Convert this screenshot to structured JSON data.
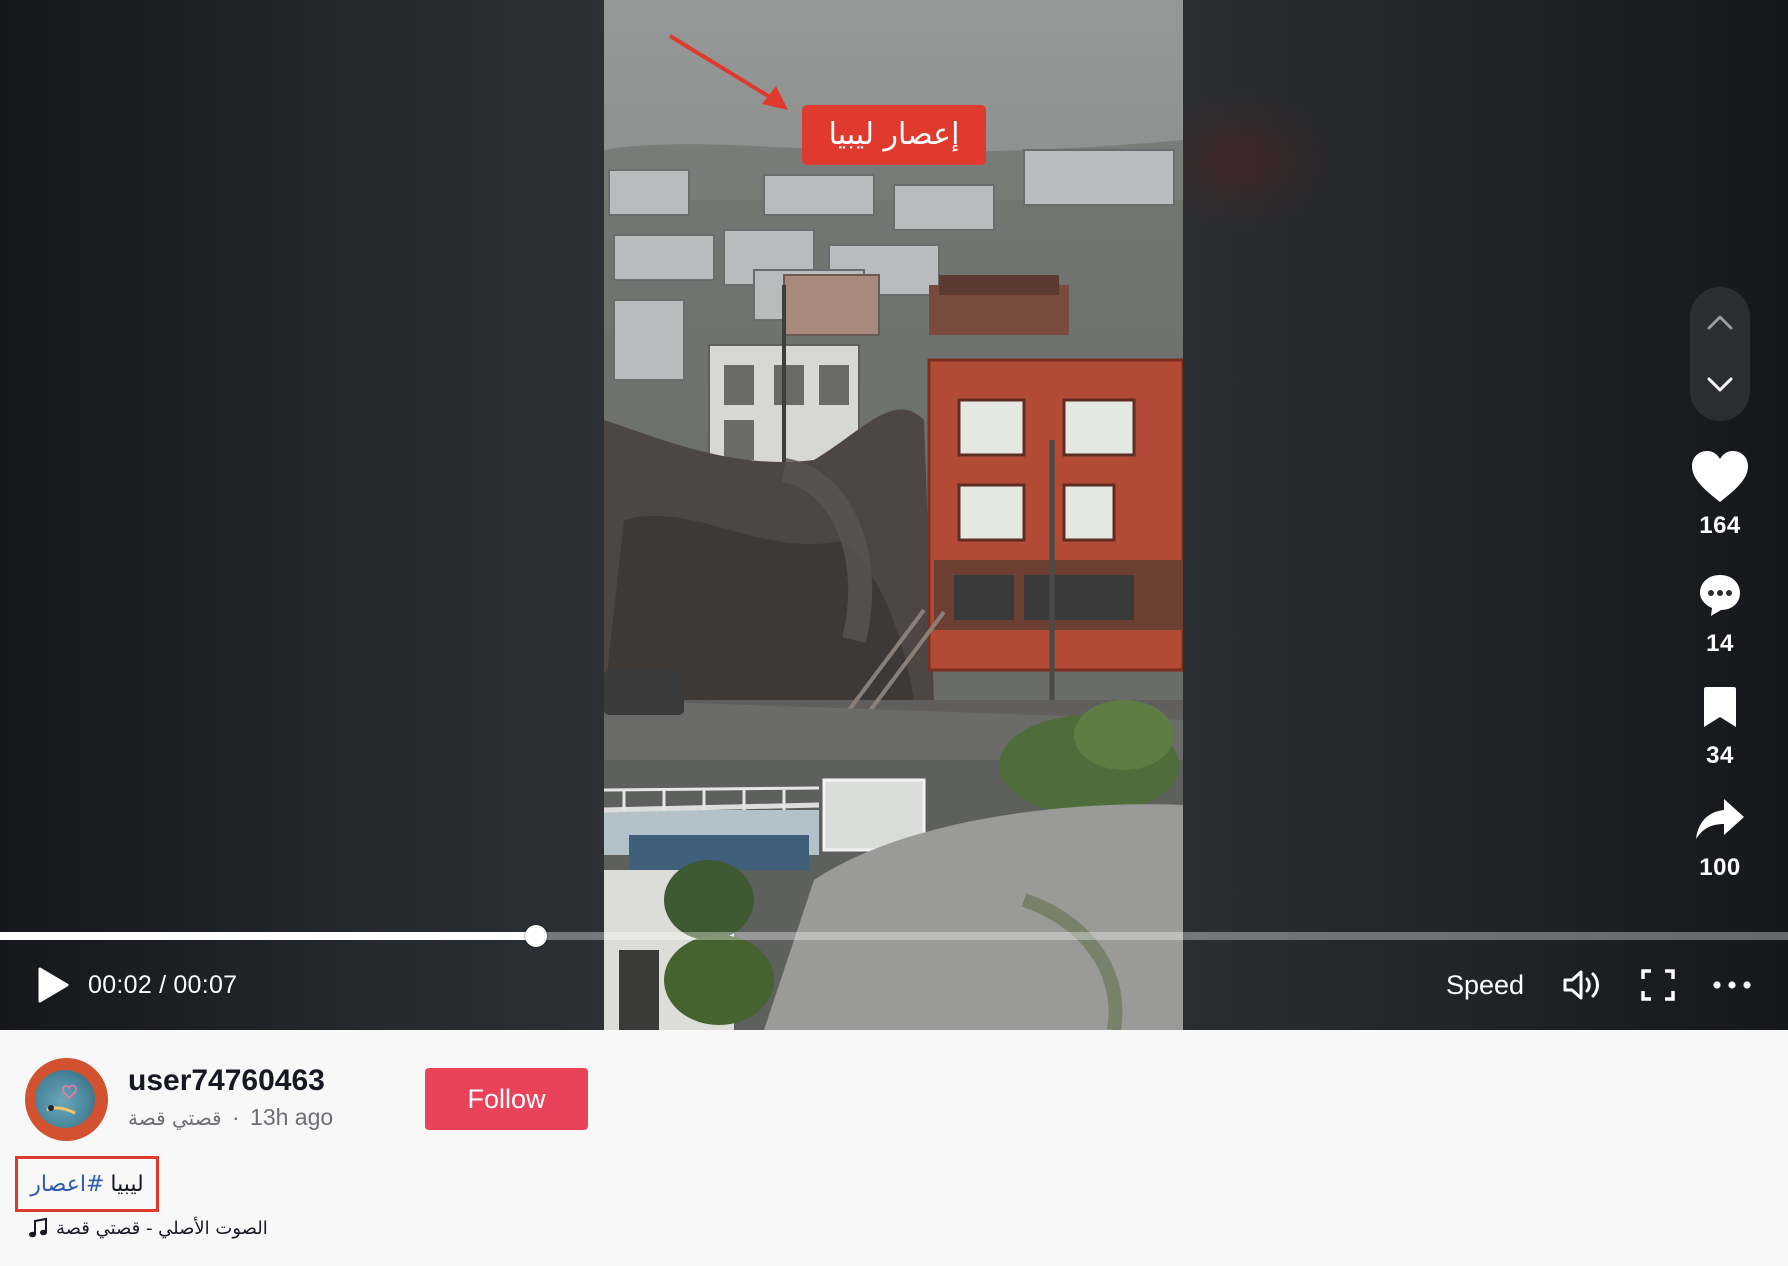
{
  "video": {
    "overlay_caption": "إعصار ليبيا",
    "current_time": "00:02",
    "duration": "00:07",
    "time_separator": "/",
    "progress_fraction": 0.3
  },
  "controls": {
    "play_icon": "play-icon",
    "speed_label": "Speed",
    "volume_icon": "volume-icon",
    "fullscreen_icon": "fullscreen-icon",
    "more_icon": "more-icon"
  },
  "actions": {
    "likes": "164",
    "comments": "14",
    "saves": "34",
    "shares": "100"
  },
  "author": {
    "username": "user74760463",
    "nickname": "قصتي قصة",
    "separator": "·",
    "posted_ago": "13h ago",
    "follow_label": "Follow"
  },
  "description": {
    "text": "ليبيا",
    "hashtag": "#اعصار"
  },
  "music": {
    "title": "الصوت الأصلي - قصتي قصة"
  },
  "colors": {
    "follow_button": "#ea4359",
    "hashtag": "#2b5bb4",
    "annotation_red": "#e03a2f",
    "page_background": "#f8f8f8",
    "player_background": "#1c1e21"
  }
}
